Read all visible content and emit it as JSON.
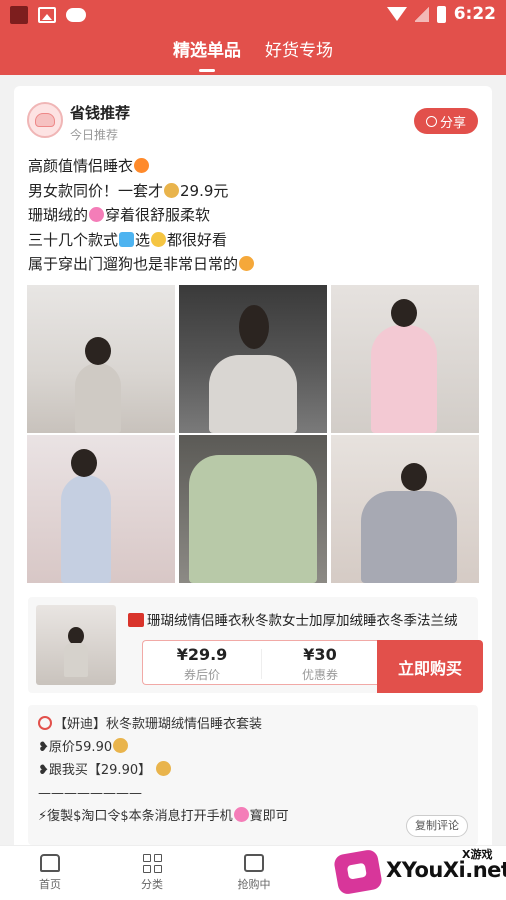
{
  "status_bar": {
    "time": "6:22"
  },
  "tabs": [
    {
      "label": "精选单品",
      "active": true
    },
    {
      "label": "好货专场",
      "active": false
    }
  ],
  "post": {
    "author": "省钱推荐",
    "subtitle": "今日推荐",
    "share_label": "分享",
    "lines": [
      "高颜值情侣睡衣",
      "男女款同价！一套才",
      "29.9元",
      "珊瑚绒的",
      "穿着很舒服柔软",
      "三十几个款式",
      "选",
      "都很好看",
      "属于穿出门遛狗也是非常日常的"
    ]
  },
  "product": {
    "title": "珊瑚绒情侣睡衣秋冬款女士加厚加绒睡衣冬季法兰绒",
    "price_after": "¥29.9",
    "price_after_label": "券后价",
    "coupon": "¥30",
    "coupon_label": "优惠券",
    "buy_label": "立即购买"
  },
  "copy_block": {
    "line1": "【妍迪】秋冬款珊瑚绒情侣睡衣套装",
    "line2": "❥原价59.90",
    "line3": "❥跟我买【29.90】",
    "line4": "————————",
    "line5": "⚡復製$淘口令$本条消息打开手机",
    "line5b": "寳即可",
    "copy_btn": "复制评论"
  },
  "bottom_nav": [
    {
      "label": "首页",
      "icon": "home-icon"
    },
    {
      "label": "分类",
      "icon": "category-icon"
    },
    {
      "label": "抢购中",
      "icon": "flash-sale-icon"
    }
  ],
  "watermark": {
    "top": "X游戏",
    "text": "XYouXi.net"
  },
  "colors": {
    "brand": "#e2504b",
    "background": "#f2f2f2"
  }
}
